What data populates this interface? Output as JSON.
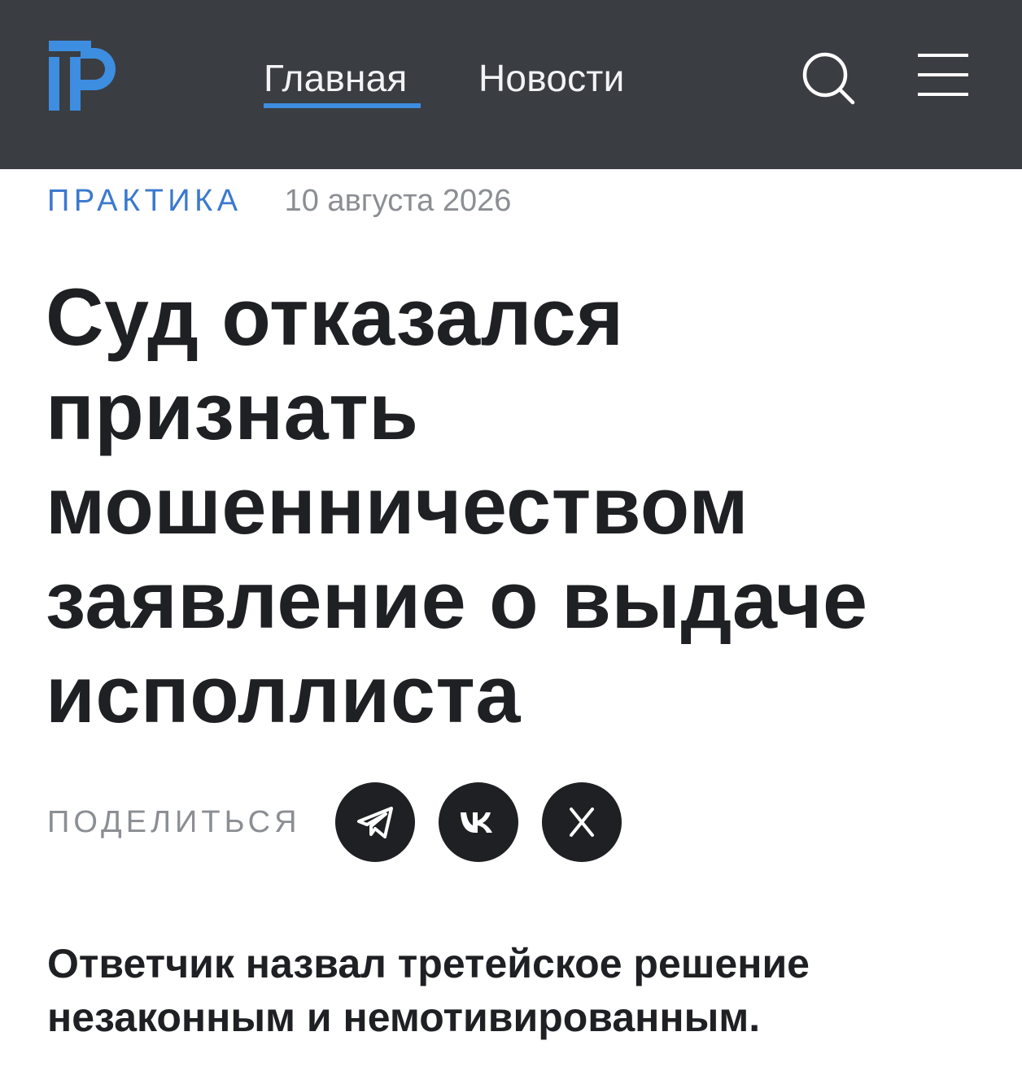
{
  "header": {
    "logo_icon": "pravo-logo-icon",
    "logo_color": "#3d8de0",
    "background_color": "#3a3d42",
    "nav": [
      {
        "label": "Главная",
        "active": true
      },
      {
        "label": "Новости",
        "active": false
      }
    ],
    "search_icon": "search-icon",
    "menu_icon": "hamburger-menu-icon"
  },
  "article": {
    "rubric": "ПРАКТИКА",
    "date": "10 августа 2026",
    "title": "Суд отказался признать мошенничеством заявление о выдаче исполлиста",
    "share": {
      "label": "ПОДЕЛИТЬСЯ",
      "buttons": [
        "telegram-icon",
        "vk-icon",
        "x-icon"
      ]
    },
    "lead": "Ответчик назвал третейское решение незаконным и немотивированным."
  },
  "colors": {
    "accent": "#3d8de0",
    "rubric": "#3a79cf",
    "muted": "#8b8e93",
    "text": "#1f2023"
  }
}
